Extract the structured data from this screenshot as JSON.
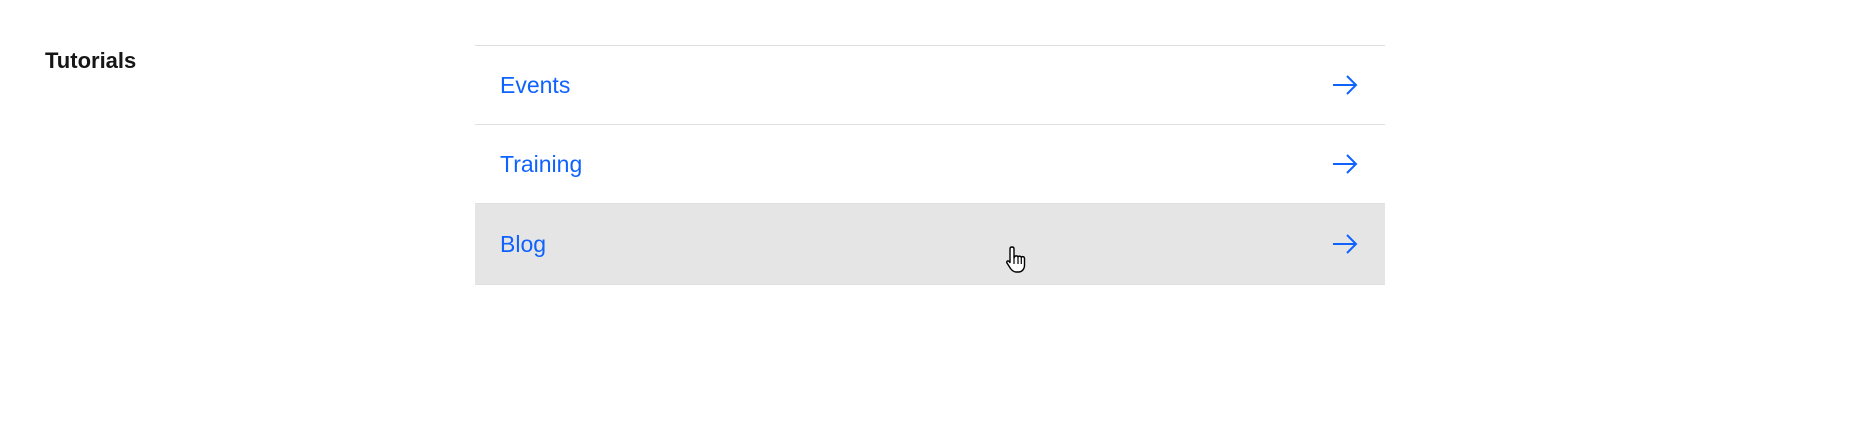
{
  "section": {
    "title": "Tutorials"
  },
  "links": [
    {
      "label": "Events",
      "icon": "arrow-right-icon"
    },
    {
      "label": "Training",
      "icon": "arrow-right-icon"
    },
    {
      "label": "Blog",
      "icon": "arrow-right-icon",
      "state": "hovered"
    }
  ],
  "colors": {
    "link": "#0f62fe",
    "heading": "#161616",
    "divider": "#e0e0e0",
    "hover_bg": "#e5e5e5"
  },
  "cursor": {
    "icon": "hand-pointer-icon"
  }
}
